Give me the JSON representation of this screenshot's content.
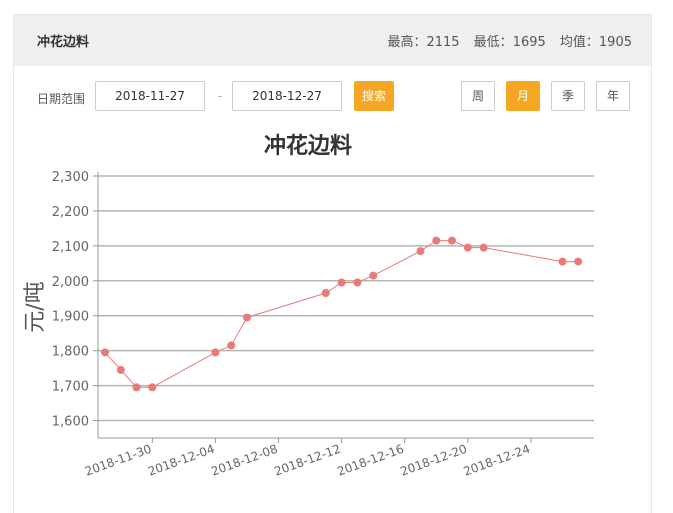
{
  "header": {
    "title": "冲花边料",
    "max_label": "最高：2115",
    "min_label": "最低：1695",
    "avg_label": "均值：1905"
  },
  "filter": {
    "label": "日期范围",
    "start_date": "2018-11-27",
    "separator": "-",
    "end_date": "2018-12-27",
    "search_label": "搜索",
    "periods": [
      "周",
      "月",
      "季",
      "年"
    ],
    "active_period": "月"
  },
  "chart_data": {
    "type": "line",
    "title": "冲花边料",
    "ylabel": "元/吨",
    "xlabel": "",
    "ylim": [
      1550,
      2300
    ],
    "yticks": [
      1600,
      1700,
      1800,
      1900,
      2000,
      2100,
      2200,
      2300
    ],
    "ytick_labels": [
      "1,600",
      "1,700",
      "1,800",
      "1,900",
      "2,000",
      "2,100",
      "2,200",
      "2,300"
    ],
    "xlim": [
      "2018-11-27",
      "2018-12-28"
    ],
    "xticks": [
      "2018-11-30",
      "2018-12-04",
      "2018-12-08",
      "2018-12-12",
      "2018-12-16",
      "2018-12-20",
      "2018-12-24"
    ],
    "grid": true,
    "line_color": "#e87a7a",
    "points": [
      {
        "x": "2018-11-27",
        "y": 1795
      },
      {
        "x": "2018-11-28",
        "y": 1745
      },
      {
        "x": "2018-11-29",
        "y": 1695
      },
      {
        "x": "2018-11-30",
        "y": 1695
      },
      {
        "x": "2018-12-04",
        "y": 1795
      },
      {
        "x": "2018-12-05",
        "y": 1815
      },
      {
        "x": "2018-12-06",
        "y": 1895
      },
      {
        "x": "2018-12-11",
        "y": 1965
      },
      {
        "x": "2018-12-12",
        "y": 1995
      },
      {
        "x": "2018-12-13",
        "y": 1995
      },
      {
        "x": "2018-12-14",
        "y": 2015
      },
      {
        "x": "2018-12-17",
        "y": 2085
      },
      {
        "x": "2018-12-18",
        "y": 2115
      },
      {
        "x": "2018-12-19",
        "y": 2115
      },
      {
        "x": "2018-12-20",
        "y": 2095
      },
      {
        "x": "2018-12-21",
        "y": 2095
      },
      {
        "x": "2018-12-26",
        "y": 2055
      },
      {
        "x": "2018-12-27",
        "y": 2055
      }
    ]
  }
}
